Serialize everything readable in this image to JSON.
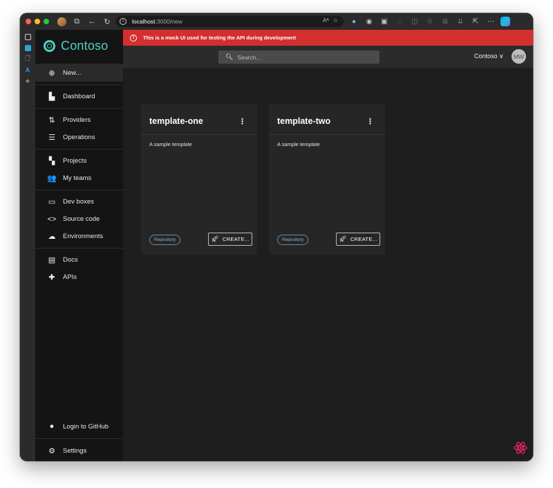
{
  "browser": {
    "url_host": "localhost",
    "url_path": ":3000/new",
    "icons": [
      "back-icon",
      "refresh-icon",
      "tabs-icon",
      "read-aloud-icon",
      "favorite-icon",
      "extensions-icon",
      "split-icon",
      "collections-icon",
      "share-icon",
      "more-icon",
      "copilot-icon"
    ],
    "addr_right": "Aᴬ  ☆"
  },
  "app": {
    "brand": "Contoso",
    "brand_color": "#4fd1c5",
    "alert_text": "This is a mock UI used for testing the API during development",
    "alert_color": "#d32f2f",
    "search_placeholder": "Search...",
    "org_label": "Contoso ∨",
    "avatar_initials": "MW"
  },
  "sidebar": {
    "new_label": "New...",
    "dashboard": "Dashboard",
    "providers": "Providers",
    "operations": "Operations",
    "projects": "Projects",
    "my_teams": "My teams",
    "dev_boxes": "Dev boxes",
    "source_code": "Source code",
    "environments": "Environments",
    "docs": "Docs",
    "apis": "APIs",
    "login_github": "Login to GitHub",
    "settings": "Settings"
  },
  "templates": [
    {
      "name": "template-one",
      "description": "A sample template",
      "tag": "Repository",
      "action": "CREATE..."
    },
    {
      "name": "template-two",
      "description": "A sample template",
      "tag": "Repository",
      "action": "CREATE..."
    }
  ]
}
